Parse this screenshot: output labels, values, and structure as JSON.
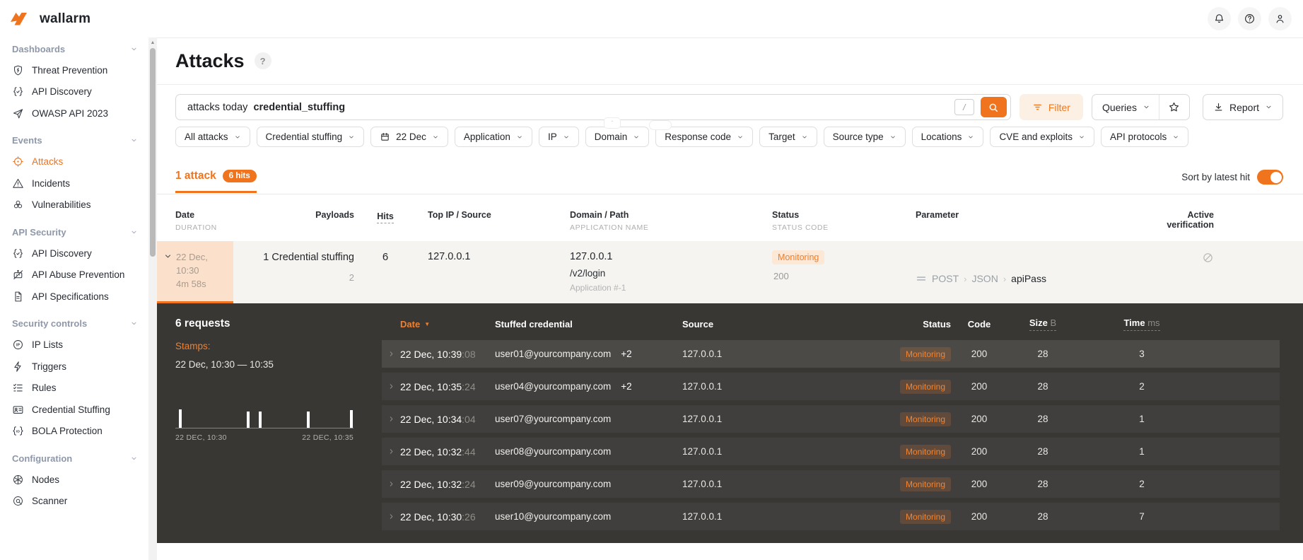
{
  "brand": {
    "name": "wallarm"
  },
  "colors": {
    "accent": "#f0731d",
    "monitoring_text": "#ee7f2d",
    "dark_panel": "#393734"
  },
  "topbar": {
    "icons": [
      {
        "name": "notifications-bell",
        "icon": "#i-bell"
      },
      {
        "name": "help",
        "icon": "#i-help"
      },
      {
        "name": "user-account",
        "icon": "#i-user"
      }
    ]
  },
  "sidebar": {
    "sections": [
      {
        "label": "Dashboards",
        "items": [
          {
            "label": "Threat Prevention",
            "icon": "#i-shield"
          },
          {
            "label": "API Discovery",
            "icon": "#i-braces"
          },
          {
            "label": "OWASP API 2023",
            "icon": "#i-plane"
          }
        ]
      },
      {
        "label": "Events",
        "items": [
          {
            "label": "Attacks",
            "icon": "#i-target",
            "cls": "active"
          },
          {
            "label": "Incidents",
            "icon": "#i-warning"
          },
          {
            "label": "Vulnerabilities",
            "icon": "#i-bio"
          }
        ]
      },
      {
        "label": "API Security",
        "items": [
          {
            "label": "API Discovery",
            "icon": "#i-braces"
          },
          {
            "label": "API Abuse Prevention",
            "icon": "#i-bot"
          },
          {
            "label": "API Specifications",
            "icon": "#i-doc"
          }
        ]
      },
      {
        "label": "Security controls",
        "items": [
          {
            "label": "IP Lists",
            "icon": "#i-ip"
          },
          {
            "label": "Triggers",
            "icon": "#i-bolt"
          },
          {
            "label": "Rules",
            "icon": "#i-checklist"
          },
          {
            "label": "Credential Stuffing",
            "icon": "#i-idcard"
          },
          {
            "label": "BOLA Protection",
            "icon": "#i-bola"
          }
        ]
      },
      {
        "label": "Configuration",
        "items": [
          {
            "label": "Nodes",
            "icon": "#i-nodes"
          },
          {
            "label": "Scanner",
            "icon": "#i-scanner"
          }
        ]
      }
    ]
  },
  "page": {
    "title": "Attacks"
  },
  "search": {
    "value_1": "attacks today",
    "value_2": "credential_stuffing",
    "kbd": "/"
  },
  "toolbar": {
    "filter": "Filter",
    "queries": "Queries",
    "report": "Report"
  },
  "filters": [
    {
      "label": "All attacks"
    },
    {
      "label": "Credential stuffing"
    },
    {
      "label": "22 Dec",
      "cls": "with-icon",
      "icon": "#i-calendar"
    },
    {
      "label": "Application"
    },
    {
      "label": "IP"
    },
    {
      "label": "Domain"
    },
    {
      "label": "Response code"
    },
    {
      "label": "Target"
    },
    {
      "label": "Source type"
    },
    {
      "label": "Locations"
    },
    {
      "label": "CVE and exploits"
    },
    {
      "label": "API protocols"
    }
  ],
  "summary": {
    "count": "1 attack",
    "hits_badge": "6 hits",
    "sort_label": "Sort by latest hit"
  },
  "attack_table": {
    "headers": {
      "date": "Date",
      "date_sub": "DURATION",
      "payloads": "Payloads",
      "hits": "Hits",
      "top_ip": "Top IP / Source",
      "domain": "Domain / Path",
      "domain_sub": "APPLICATION NAME",
      "status": "Status",
      "status_sub": "STATUS CODE",
      "parameter": "Parameter",
      "active_verification": "Active verification"
    },
    "row": {
      "date": "22 Dec, 10:30",
      "duration": "4m 58s",
      "payloads": "1 Credential stuffing",
      "payloads_count": "2",
      "hits": "6",
      "top_ip": "127.0.0.1",
      "domain": "127.0.0.1",
      "path": "/v2/login",
      "app": "Application #-1",
      "status": "Monitoring",
      "status_code": "200",
      "param_method": "POST",
      "param_sep": "›",
      "param_type": "JSON",
      "param_name": "apiPass"
    }
  },
  "detail": {
    "title": "6 requests",
    "stamps_label": "Stamps:",
    "range": "22 Dec, 10:30 — 10:35",
    "chart": {
      "type": "event-timeline",
      "start_label": "22 DEC, 10:30",
      "end_label": "22 DEC, 10:35",
      "ticks": [
        {
          "style": "left:2%;height:26px"
        },
        {
          "style": "left:40%;height:23px"
        },
        {
          "style": "left:47%;height:23px"
        },
        {
          "style": "left:74%;height:23px"
        },
        {
          "style": "left:98%;height:25px"
        }
      ]
    },
    "table": {
      "headers": {
        "date": "Date",
        "credential": "Stuffed credential",
        "source": "Source",
        "status": "Status",
        "code": "Code",
        "size": "Size",
        "size_unit": "B",
        "time": "Time",
        "time_unit": "ms"
      },
      "rows": [
        {
          "cls": "selected",
          "date": "22 Dec, 10:39",
          "sec": ":08",
          "credential": "user01@yourcompany.com",
          "extra": "+2",
          "source": "127.0.0.1",
          "status": "Monitoring",
          "code": "200",
          "size": "28",
          "time": "3"
        },
        {
          "date": "22 Dec, 10:35",
          "sec": ":24",
          "credential": "user04@yourcompany.com",
          "extra": "+2",
          "source": "127.0.0.1",
          "status": "Monitoring",
          "code": "200",
          "size": "28",
          "time": "2"
        },
        {
          "date": "22 Dec, 10:34",
          "sec": ":04",
          "credential": "user07@yourcompany.com",
          "extra": "",
          "source": "127.0.0.1",
          "status": "Monitoring",
          "code": "200",
          "size": "28",
          "time": "1"
        },
        {
          "date": "22 Dec, 10:32",
          "sec": ":44",
          "credential": "user08@yourcompany.com",
          "extra": "",
          "source": "127.0.0.1",
          "status": "Monitoring",
          "code": "200",
          "size": "28",
          "time": "1"
        },
        {
          "date": "22 Dec, 10:32",
          "sec": ":24",
          "credential": "user09@yourcompany.com",
          "extra": "",
          "source": "127.0.0.1",
          "status": "Monitoring",
          "code": "200",
          "size": "28",
          "time": "2"
        },
        {
          "date": "22 Dec, 10:30",
          "sec": ":26",
          "credential": "user10@yourcompany.com",
          "extra": "",
          "source": "127.0.0.1",
          "status": "Monitoring",
          "code": "200",
          "size": "28",
          "time": "7"
        }
      ]
    }
  }
}
